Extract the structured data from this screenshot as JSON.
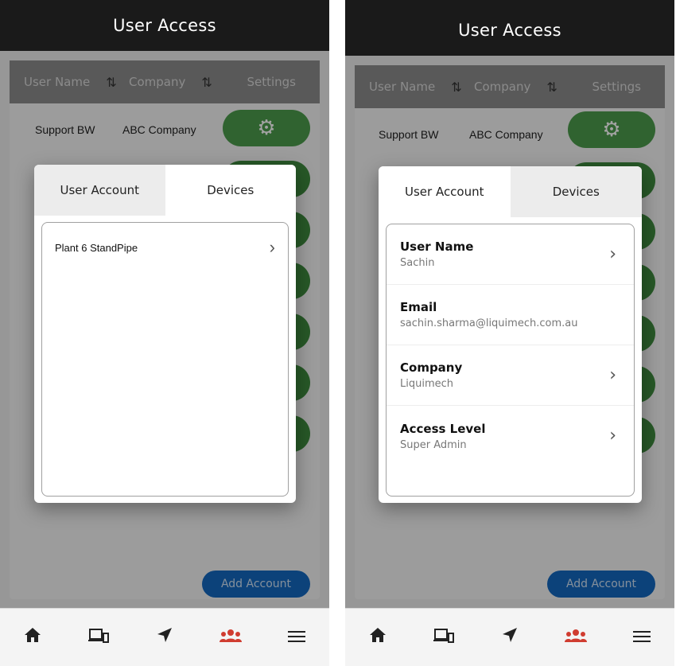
{
  "header": {
    "title": "User Access"
  },
  "table": {
    "col_user": "User Name",
    "col_company": "Company",
    "col_settings": "Settings",
    "rows": [
      {
        "user": "Support BW",
        "company": "ABC Company"
      }
    ]
  },
  "add_account_label": "Add Account",
  "left_modal": {
    "tabs": [
      "User Account",
      "Devices"
    ],
    "active_tab": "Devices",
    "devices": [
      {
        "name": "Plant 6 StandPipe"
      }
    ]
  },
  "right_modal": {
    "tabs": [
      "User Account",
      "Devices"
    ],
    "active_tab": "User Account",
    "fields": [
      {
        "label": "User Name",
        "value": "Sachin",
        "has_chevron": true
      },
      {
        "label": "Email",
        "value": "sachin.sharma@liquimech.com.au",
        "has_chevron": false
      },
      {
        "label": "Company",
        "value": "Liquimech",
        "has_chevron": true
      },
      {
        "label": "Access Level",
        "value": "Super Admin",
        "has_chevron": true
      }
    ]
  },
  "nav": {
    "items": [
      "home-icon",
      "devices-icon",
      "location-arrow-icon",
      "users-icon",
      "menu-icon"
    ],
    "active": "users-icon"
  },
  "colors": {
    "header": "#1a1a1a",
    "gear_button": "#4c9b4c",
    "add_button": "#1468bf",
    "active_nav": "#d03c30"
  }
}
